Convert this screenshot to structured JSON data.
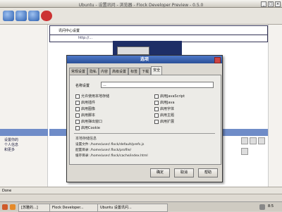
{
  "window": {
    "title": "Ubuntu - 设置讯问 - 浏览器 - Flock Developer Preview - 0.5.0"
  },
  "browser": {
    "url_text": "http://..."
  },
  "background_page": {
    "header_text": "讯问中心设置",
    "left_note_lines": [
      "设置你的",
      "个人信息",
      "和更多"
    ]
  },
  "dialog": {
    "title": "选项",
    "tabs": [
      "常规设置",
      "隐私",
      "内容",
      "高级设置",
      "标签",
      "下载",
      "安全"
    ],
    "active_tab_index": 6,
    "name_label": "名称设置",
    "name_value": "...",
    "options_left": [
      "允许使用本地存储",
      "启用插件",
      "启用图像",
      "启用脚本",
      "启用弹出窗口",
      "启用Cookie"
    ],
    "options_right": [
      "启用JavaScript",
      "启用Java",
      "启用字体",
      "启用主题",
      "启用扩展"
    ],
    "info_heading": "本地存储信息",
    "info_lines": [
      "设置文件: /home/user/.flock/default/prefs.js",
      "配置目录: /home/user/.flock/profile/",
      "缓存目录: /home/user/.flock/cache/index.html"
    ],
    "buttons": {
      "ok": "确定",
      "cancel": "取消",
      "help": "帮助"
    }
  },
  "statusbar": {
    "text": "Done"
  },
  "taskbar": {
    "items": [
      "[苏雅的...]",
      "Flock Developer...",
      "Ubuntu 设置讯问..."
    ],
    "tray_time": "8:5"
  }
}
